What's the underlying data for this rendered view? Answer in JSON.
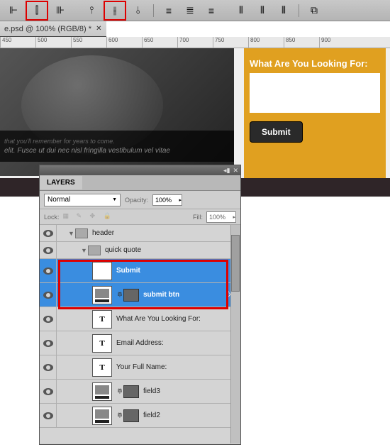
{
  "doc_tab": "e.psd @ 100% (RGB/8) *",
  "ruler": [
    "450",
    "500",
    "550",
    "600",
    "650",
    "700",
    "750",
    "800",
    "850",
    "900"
  ],
  "hero_caption": "elit. Fusce ut dui nec nisl fringilla vestibulum vel vitae",
  "hero_subcaption": "that you'll remember for years to come.",
  "form": {
    "title": "What Are You Looking For:",
    "submit": "Submit"
  },
  "panel": {
    "title": "LAYERS",
    "blend": "Normal",
    "opacity_label": "Opacity:",
    "opacity": "100%",
    "lock_label": "Lock:",
    "fill_label": "Fill:",
    "fill": "100%"
  },
  "layers": {
    "header": "header",
    "quick_quote": "quick quote",
    "submit": "Submit",
    "submit_btn": "submit btn",
    "what": "What Are You Looking For:",
    "email": "Email Address:",
    "name": "Your Full Name:",
    "field3": "field3",
    "field2": "field2"
  }
}
